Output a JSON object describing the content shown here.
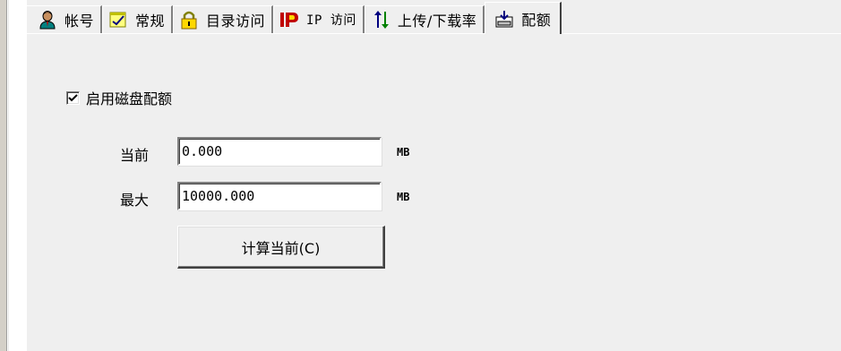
{
  "tabs": [
    {
      "label": "帐号",
      "icon": "user-icon"
    },
    {
      "label": "常规",
      "icon": "general-icon"
    },
    {
      "label": "目录访问",
      "icon": "lock-icon"
    },
    {
      "label": "IP 访问",
      "icon": "ip-icon"
    },
    {
      "label": "上传/下载率",
      "icon": "updown-arrows-icon"
    },
    {
      "label": "配额",
      "icon": "disk-quota-icon",
      "active": true
    }
  ],
  "quota": {
    "enable_label": "启用磁盘配额",
    "enable_checked": true,
    "current_label": "当前",
    "current_value": "0.000",
    "current_unit": "MB",
    "max_label": "最大",
    "max_value": "10000.000",
    "max_unit": "MB",
    "calculate_button": "计算当前(C)"
  },
  "colors": {
    "face": "#efefef",
    "highlight": "#ffffff",
    "shadow": "#808080",
    "dark_shadow": "#404040"
  }
}
